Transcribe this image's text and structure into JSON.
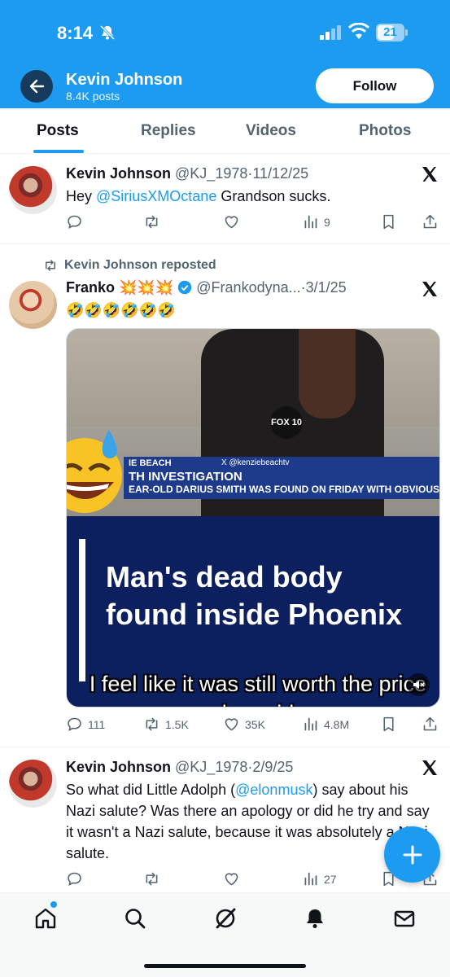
{
  "status_bar": {
    "time": "8:14",
    "battery": "21"
  },
  "header": {
    "name": "Kevin Johnson",
    "posts": "8.4K posts",
    "follow_label": "Follow"
  },
  "tabs": [
    {
      "label": "Posts",
      "active": true
    },
    {
      "label": "Replies",
      "active": false
    },
    {
      "label": "Videos",
      "active": false
    },
    {
      "label": "Photos",
      "active": false
    }
  ],
  "tweets": [
    {
      "name": "Kevin Johnson",
      "handle": "@KJ_1978",
      "sep": "·",
      "date": "11/12/25",
      "text_before": "Hey ",
      "mention": "@SiriusXMOctane",
      "text_after": " Grandson sucks.",
      "views": "9"
    },
    {
      "repost_label": "Kevin Johnson reposted",
      "name": "Franko 💥💥💥",
      "handle": "@Frankodyna...",
      "sep": "·",
      "date": "3/1/25",
      "text": "🤣🤣🤣🤣🤣🤣",
      "media": {
        "banner_left": "IE BEACH",
        "banner_x": "X @kenziebeachtv",
        "banner_title": "TH INVESTIGATION",
        "banner_ticker": "EAR-OLD DARIUS SMITH WAS FOUND ON FRIDAY WITH OBVIOUS S",
        "mic_label": "FOX 10",
        "headline": "Man's dead body found inside Phoenix",
        "caption": "I feel like it was still worth the price he paid"
      },
      "replies": "111",
      "reposts": "1.5K",
      "likes": "35K",
      "views": "4.8M"
    },
    {
      "name": "Kevin Johnson",
      "handle": "@KJ_1978",
      "sep": "·",
      "date": "2/9/25",
      "text_before": "So what did Little Adolph  (",
      "mention": "@elonmusk",
      "text_after": ") say about his Nazi salute? Was there an apology or did he try and say it wasn't a Nazi salute, because it was absolutely a Nazi salute.",
      "views": "27"
    }
  ],
  "icons": {
    "back": "arrow-left-icon",
    "compose": "plus-icon",
    "nav": [
      "home-icon",
      "search-icon",
      "grok-icon",
      "bell-icon",
      "mail-icon"
    ]
  },
  "colors": {
    "accent": "#1d9bf0",
    "text": "#0f1419",
    "muted": "#536471"
  }
}
